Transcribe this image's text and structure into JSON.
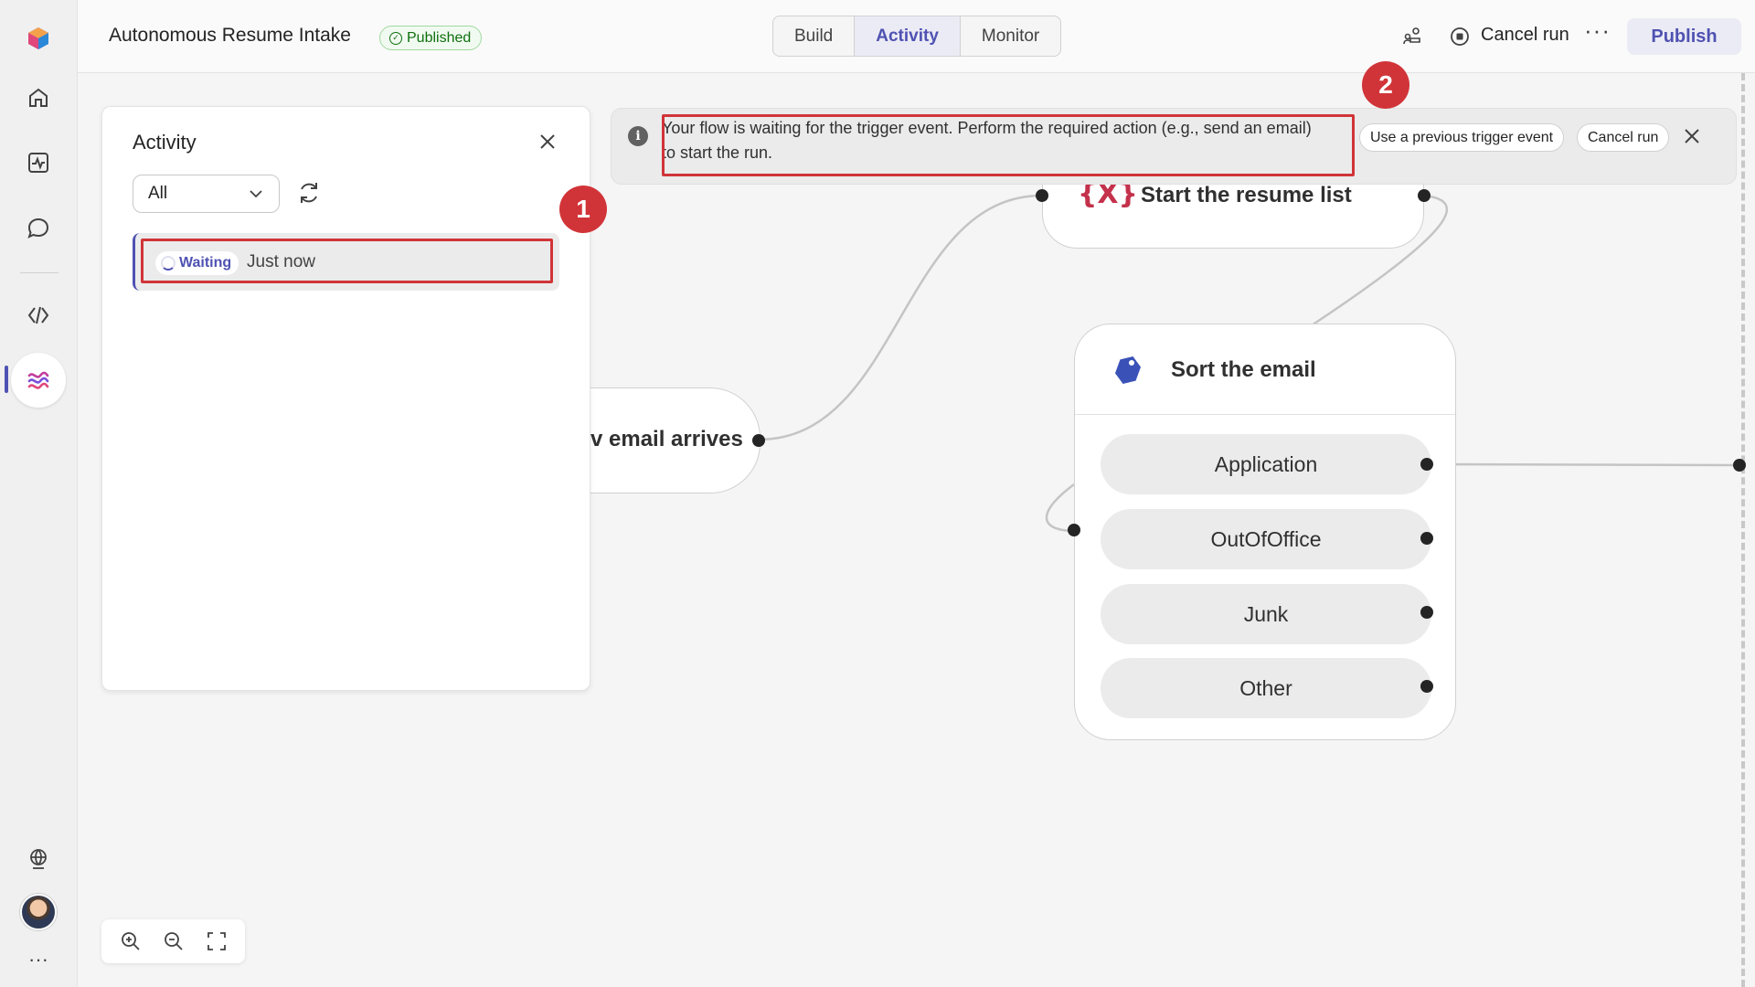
{
  "header": {
    "app_title": "Autonomous Resume Intake",
    "status_badge": "Published",
    "tabs": [
      {
        "label": "Build",
        "active": false
      },
      {
        "label": "Activity",
        "active": true
      },
      {
        "label": "Monitor",
        "active": false
      }
    ],
    "cancel_run_label": "Cancel run",
    "more_label": "···",
    "publish_label": "Publish"
  },
  "rail": {
    "items": [
      {
        "icon": "home-icon"
      },
      {
        "icon": "activity-icon"
      },
      {
        "icon": "chat-icon"
      },
      {
        "icon": "code-icon"
      },
      {
        "icon": "flows-icon",
        "active": true
      }
    ],
    "bottom": [
      {
        "icon": "globe-icon"
      },
      {
        "icon": "avatar"
      },
      {
        "icon": "more-icon",
        "label": "···"
      }
    ]
  },
  "banner": {
    "message": "Your flow is waiting for the trigger event. Perform the required action (e.g., send an email) to start the run.",
    "use_previous_label": "Use a previous trigger event",
    "cancel_run_label": "Cancel run"
  },
  "activity_panel": {
    "title": "Activity",
    "filter_value": "All",
    "runs": [
      {
        "status": "Waiting",
        "time": "Just now"
      }
    ]
  },
  "canvas": {
    "trigger_node_label": "v email arrives",
    "list_node_icon": "{X}",
    "list_node_label": "Start the resume list",
    "sort_node_label": "Sort the email",
    "branches": [
      "Application",
      "OutOfOffice",
      "Junk",
      "Other"
    ]
  },
  "callouts": [
    "1",
    "2"
  ],
  "colors": {
    "accent": "#4f52b2",
    "callout_red": "#d13438",
    "published_green": "#0e700e"
  }
}
